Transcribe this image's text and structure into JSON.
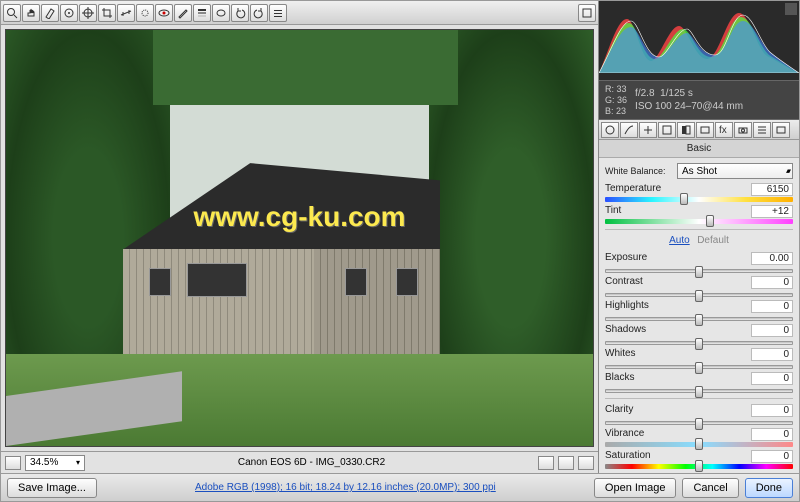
{
  "toolbar": {
    "tools": [
      {
        "name": "zoom-icon"
      },
      {
        "name": "hand-icon"
      },
      {
        "name": "white-balance-icon"
      },
      {
        "name": "color-sampler-icon"
      },
      {
        "name": "target-adjust-icon"
      },
      {
        "name": "crop-icon"
      },
      {
        "name": "straighten-icon"
      },
      {
        "name": "spot-removal-icon"
      },
      {
        "name": "redeye-icon"
      },
      {
        "name": "adjustment-brush-icon"
      },
      {
        "name": "graduated-filter-icon"
      },
      {
        "name": "radial-filter-icon"
      },
      {
        "name": "rotate-ccw-icon"
      },
      {
        "name": "rotate-cw-icon"
      },
      {
        "name": "preferences-icon"
      }
    ],
    "right_tool": "toggle-preview-icon"
  },
  "preview": {
    "watermark": "www.cg-ku.com",
    "zoom": "34.5%",
    "camera_file": "Canon EOS 6D  -  IMG_0330.CR2"
  },
  "histogram": {
    "rgb": {
      "r_label": "R:",
      "r": "33",
      "g_label": "G:",
      "g": "36",
      "b_label": "B:",
      "b": "23"
    },
    "aperture": "f/2.8",
    "shutter": "1/125 s",
    "iso_lens": "ISO 100   24–70@44 mm"
  },
  "panel": {
    "title": "Basic",
    "white_balance_label": "White Balance:",
    "white_balance_value": "As Shot",
    "auto": "Auto",
    "default": "Default",
    "sliders": {
      "temperature": {
        "label": "Temperature",
        "value": "6150",
        "pct": 42
      },
      "tint": {
        "label": "Tint",
        "value": "+12",
        "pct": 56
      },
      "exposure": {
        "label": "Exposure",
        "value": "0.00",
        "pct": 50
      },
      "contrast": {
        "label": "Contrast",
        "value": "0",
        "pct": 50
      },
      "highlights": {
        "label": "Highlights",
        "value": "0",
        "pct": 50
      },
      "shadows": {
        "label": "Shadows",
        "value": "0",
        "pct": 50
      },
      "whites": {
        "label": "Whites",
        "value": "0",
        "pct": 50
      },
      "blacks": {
        "label": "Blacks",
        "value": "0",
        "pct": 50
      },
      "clarity": {
        "label": "Clarity",
        "value": "0",
        "pct": 50
      },
      "vibrance": {
        "label": "Vibrance",
        "value": "0",
        "pct": 50
      },
      "saturation": {
        "label": "Saturation",
        "value": "0",
        "pct": 50
      }
    }
  },
  "footer": {
    "save_image": "Save Image...",
    "color_info": "Adobe RGB (1998); 16 bit; 18.24 by 12.16 inches (20.0MP); 300 ppi",
    "open_image": "Open Image",
    "cancel": "Cancel",
    "done": "Done"
  }
}
